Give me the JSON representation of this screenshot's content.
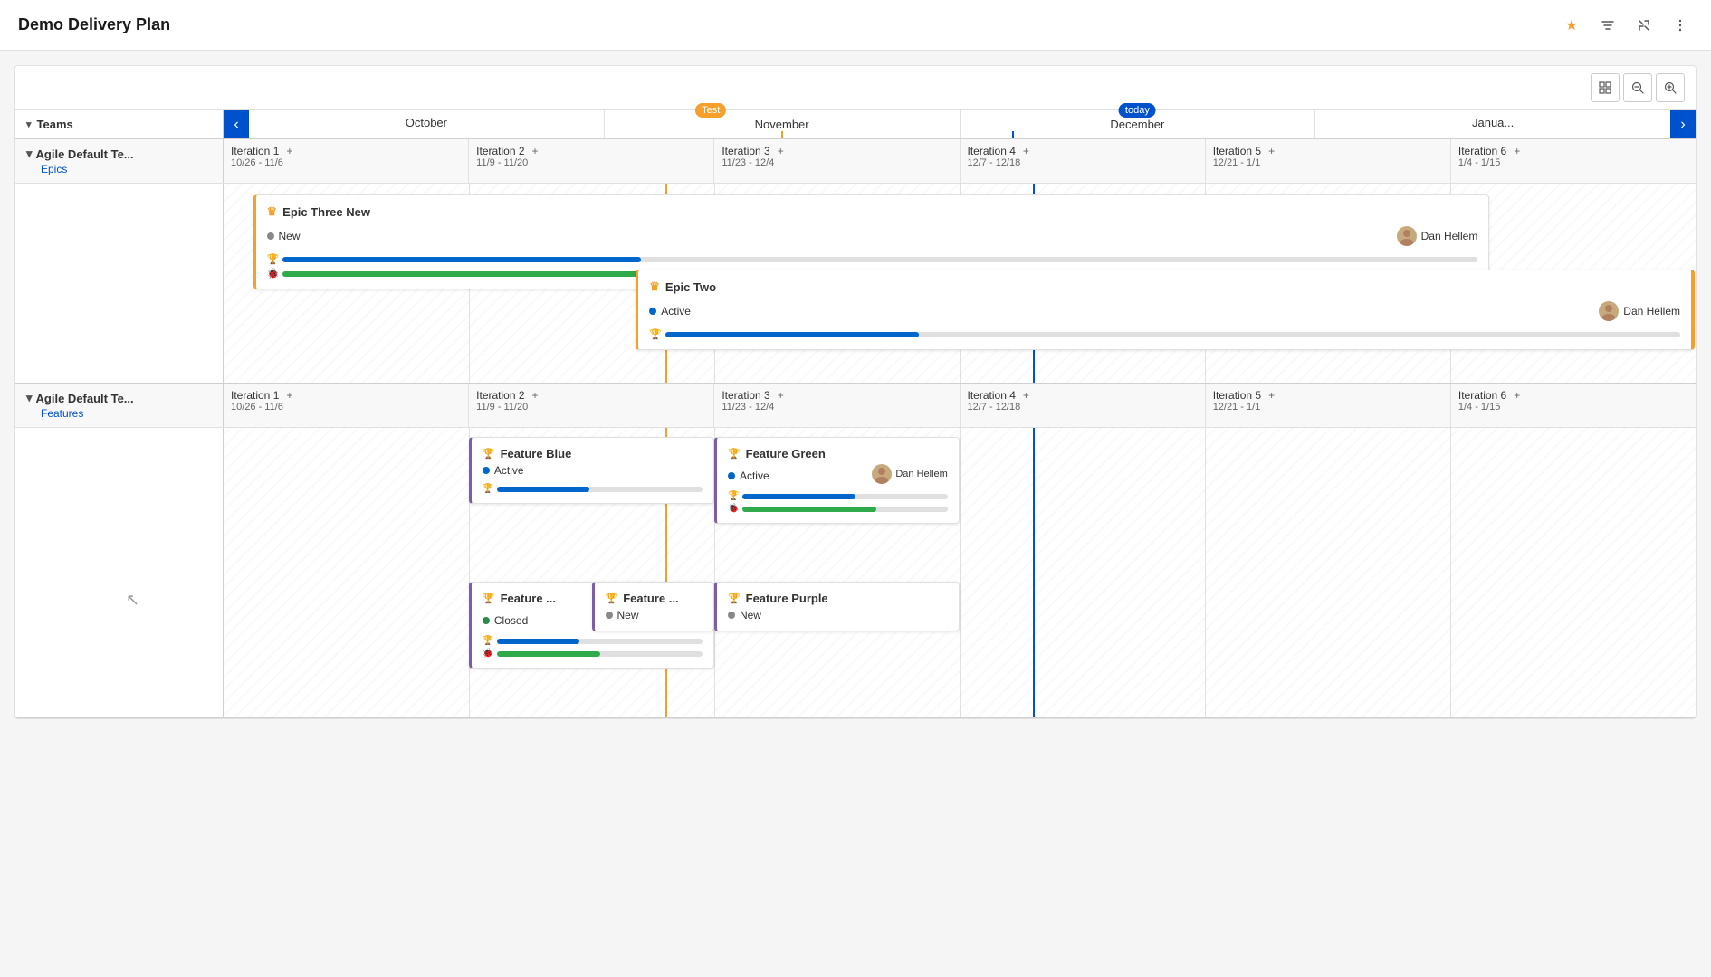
{
  "app": {
    "title": "Demo Delivery Plan"
  },
  "toolbar": {
    "zoom_out": "−",
    "zoom_in": "+",
    "grid": "▦"
  },
  "timeline": {
    "teams_label": "Teams",
    "nav_prev": "‹",
    "nav_next": "›",
    "months": [
      "October",
      "November",
      "December",
      "Janua..."
    ],
    "today_label": "today",
    "test_label": "Test"
  },
  "sections": [
    {
      "id": "section1",
      "team_name": "Agile Default Te...",
      "sub_label": "Epics",
      "iterations": [
        {
          "name": "Iteration 1",
          "dates": "10/26 - 11/6"
        },
        {
          "name": "Iteration 2",
          "dates": "11/9 - 11/20"
        },
        {
          "name": "Iteration 3",
          "dates": "11/23 - 12/4"
        },
        {
          "name": "Iteration 4",
          "dates": "12/7 - 12/18"
        },
        {
          "name": "Iteration 5",
          "dates": "12/21 - 1/1"
        },
        {
          "name": "Iteration 6",
          "dates": "1/4 - 1/15"
        }
      ],
      "epics": [
        {
          "id": "epic-three",
          "title": "Epic Three New",
          "status": "New",
          "status_type": "new",
          "assignee": "Dan Hellem",
          "progress_blue": 30,
          "progress_green": 60,
          "left_pct": 0,
          "width_pct": 85
        },
        {
          "id": "epic-two",
          "title": "Epic Two",
          "status": "Active",
          "status_type": "active",
          "assignee": "Dan Hellem",
          "progress_blue": 25,
          "progress_green": 0,
          "left_pct": 28,
          "width_pct": 72
        }
      ]
    },
    {
      "id": "section2",
      "team_name": "Agile Default Te...",
      "sub_label": "Features",
      "iterations": [
        {
          "name": "Iteration 1",
          "dates": "10/26 - 11/6"
        },
        {
          "name": "Iteration 2",
          "dates": "11/9 - 11/20"
        },
        {
          "name": "Iteration 3",
          "dates": "11/23 - 12/4"
        },
        {
          "name": "Iteration 4",
          "dates": "12/7 - 12/18"
        },
        {
          "name": "Iteration 5",
          "dates": "12/21 - 1/1"
        },
        {
          "name": "Iteration 6",
          "dates": "1/4 - 1/15"
        }
      ],
      "features": [
        {
          "id": "feature-blue",
          "title": "Feature Blue",
          "status": "Active",
          "status_type": "active",
          "assignee": "",
          "progress_blue": 45,
          "progress_green": 0,
          "col": 1,
          "row": 0
        },
        {
          "id": "feature-green",
          "title": "Feature Green",
          "status": "Active",
          "status_type": "active",
          "assignee": "Dan Hellem",
          "progress_blue": 55,
          "progress_green": 65,
          "col": 2,
          "row": 0
        },
        {
          "id": "feature-f1",
          "title": "Feature ...",
          "status": "Closed",
          "status_type": "closed",
          "assignee_avatar": true,
          "progress_blue": 40,
          "progress_green": 50,
          "col": 1,
          "row": 1
        },
        {
          "id": "feature-f2",
          "title": "Feature ...",
          "status": "New",
          "status_type": "new",
          "assignee": "",
          "progress_blue": 0,
          "progress_green": 0,
          "col": 1,
          "row": 1,
          "offset": true
        },
        {
          "id": "feature-purple",
          "title": "Feature Purple",
          "status": "New",
          "status_type": "new",
          "assignee": "",
          "progress_blue": 0,
          "progress_green": 0,
          "col": 2,
          "row": 1
        }
      ]
    }
  ],
  "icons": {
    "chevron_down": "▾",
    "chevron_right": "›",
    "chevron_left": "‹",
    "crown": "♛",
    "trophy": "🏆",
    "bug": "🐞",
    "star": "★",
    "filter": "⧫",
    "collapse": "⤡",
    "more": "⋯",
    "grid": "▦",
    "zoom_in": "+",
    "zoom_out": "−"
  }
}
